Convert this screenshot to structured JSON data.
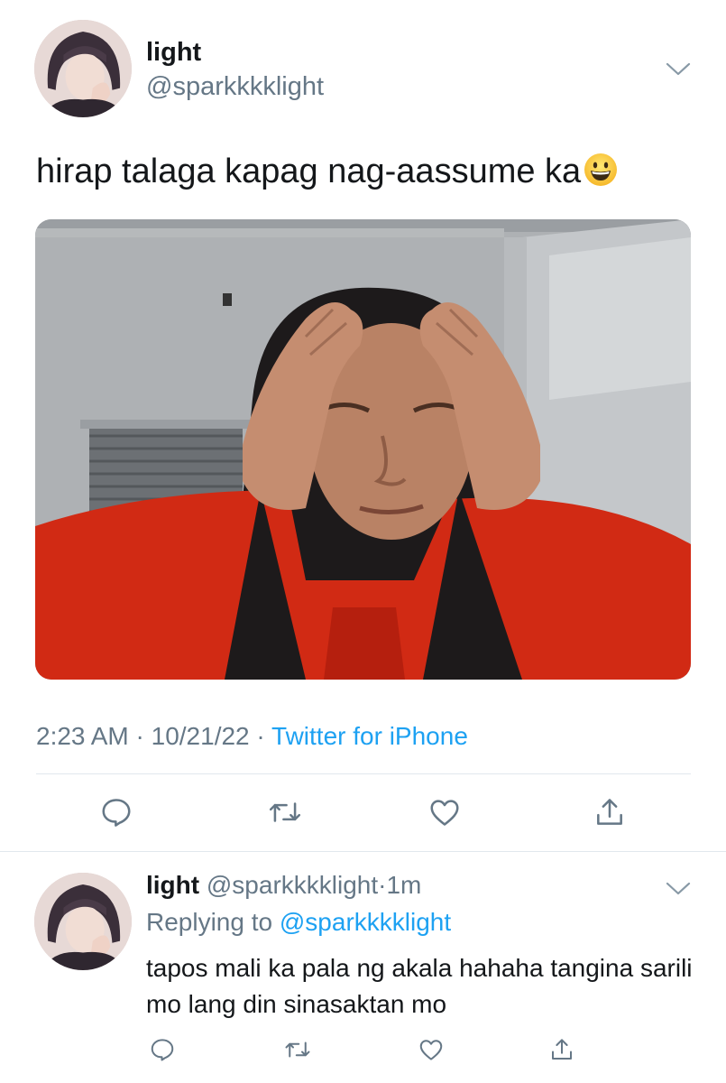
{
  "tweet": {
    "display_name": "light",
    "handle": "@sparkkkklight",
    "text": "hirap talaga kapag nag-aassume ka",
    "emoji": "grinning-face-emoji",
    "time": "2:23 AM",
    "date": "10/21/22",
    "separator": " · ",
    "source": "Twitter for iPhone"
  },
  "reply": {
    "display_name": "light",
    "handle": "@sparkkkklight",
    "separator": "·",
    "age": "1m",
    "replying_label": "Replying to ",
    "replying_to": "@sparkkkklight",
    "text": "tapos mali ka pala ng akala hahaha tangina sarili mo lang din sinasaktan mo"
  },
  "actions": [
    "reply-icon",
    "retweet-icon",
    "like-icon",
    "share-icon"
  ],
  "colors": {
    "link": "#1da1f2",
    "secondary_text": "#657786",
    "primary_text": "#14171a",
    "divider": "#e1e8ed"
  }
}
